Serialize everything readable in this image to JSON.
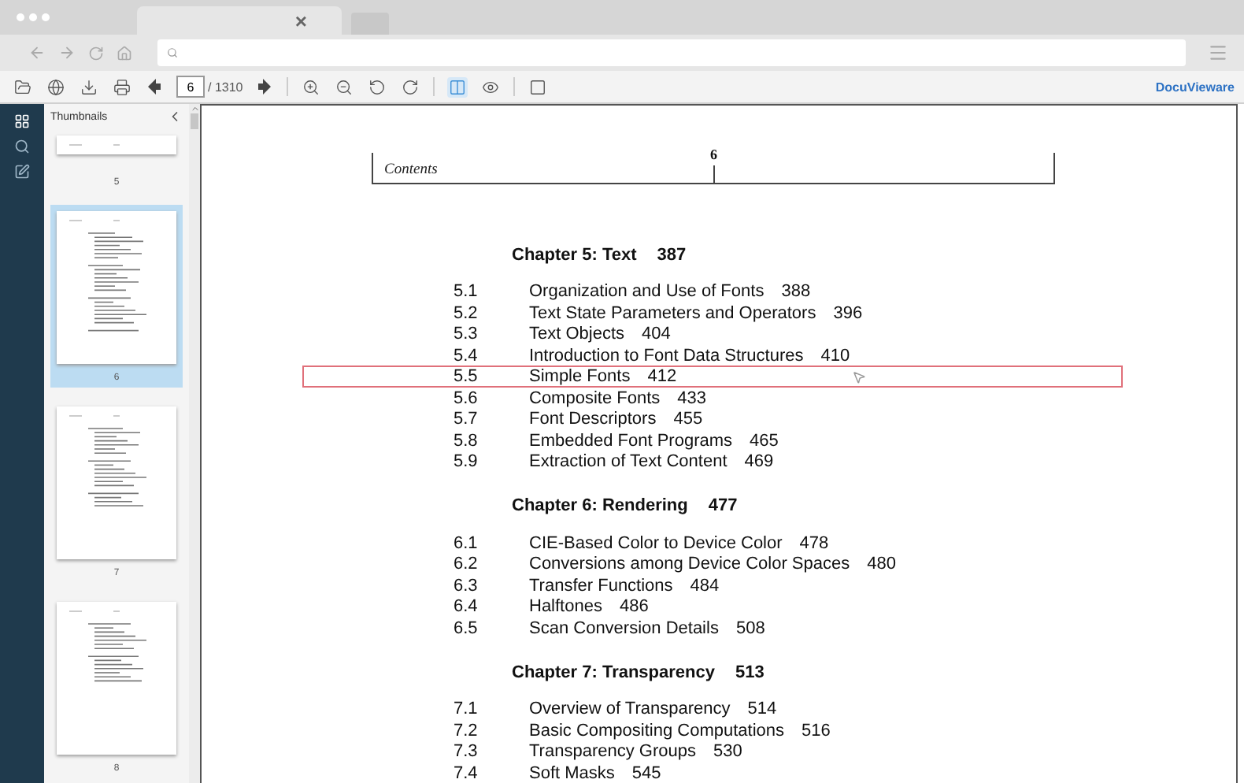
{
  "browser": {
    "tab_close": "×"
  },
  "toolbar": {
    "tools": [
      {
        "kind": "open",
        "selected": false
      },
      {
        "kind": "web",
        "selected": false
      },
      {
        "kind": "download",
        "selected": false
      },
      {
        "kind": "print",
        "selected": false
      },
      {
        "kind": "prev",
        "selected": false
      },
      {
        "kind": "page",
        "selected": false
      },
      {
        "kind": "next",
        "selected": false
      },
      {
        "kind": "zoom-in",
        "selected": false
      },
      {
        "kind": "zoom-out",
        "selected": false
      },
      {
        "kind": "rotate-left",
        "selected": false
      },
      {
        "kind": "rotate-right",
        "selected": false
      },
      {
        "kind": "fit",
        "selected": true
      },
      {
        "kind": "view",
        "selected": false
      },
      {
        "kind": "frame",
        "selected": false
      }
    ],
    "page_input": "6",
    "page_count": "/ 1310",
    "brand": "DocuVieware"
  },
  "sidebar": {
    "title": "Thumbnails",
    "tabs": [
      {
        "kind": "thumbnails",
        "selected": true
      },
      {
        "kind": "search",
        "selected": false
      },
      {
        "kind": "annotate",
        "selected": false
      }
    ],
    "thumbnails": [
      {
        "label": "5",
        "selected": false
      },
      {
        "label": "6",
        "selected": true
      },
      {
        "label": "7",
        "selected": false
      },
      {
        "label": "8",
        "selected": false
      }
    ]
  },
  "document": {
    "running_head": "Contents",
    "page_number": "6",
    "chapters": [
      {
        "title": "Chapter 5: Text",
        "page": "387",
        "entries": [
          {
            "number": "5.1",
            "title": "Organization and Use of Fonts",
            "page": "388",
            "highlighted": false
          },
          {
            "number": "5.2",
            "title": "Text State Parameters and Operators",
            "page": "396",
            "highlighted": false
          },
          {
            "number": "5.3",
            "title": "Text Objects",
            "page": "404",
            "highlighted": false
          },
          {
            "number": "5.4",
            "title": "Introduction to Font Data Structures",
            "page": "410",
            "highlighted": false
          },
          {
            "number": "5.5",
            "title": "Simple Fonts",
            "page": "412",
            "highlighted": true
          },
          {
            "number": "5.6",
            "title": "Composite Fonts",
            "page": "433",
            "highlighted": false
          },
          {
            "number": "5.7",
            "title": "Font Descriptors",
            "page": "455",
            "highlighted": false
          },
          {
            "number": "5.8",
            "title": "Embedded Font Programs",
            "page": "465",
            "highlighted": false
          },
          {
            "number": "5.9",
            "title": "Extraction of Text Content",
            "page": "469",
            "highlighted": false
          }
        ]
      },
      {
        "title": "Chapter 6: Rendering",
        "page": "477",
        "entries": [
          {
            "number": "6.1",
            "title": "CIE-Based Color to Device Color",
            "page": "478",
            "highlighted": false
          },
          {
            "number": "6.2",
            "title": "Conversions among Device Color Spaces",
            "page": "480",
            "highlighted": false
          },
          {
            "number": "6.3",
            "title": "Transfer Functions",
            "page": "484",
            "highlighted": false
          },
          {
            "number": "6.4",
            "title": "Halftones",
            "page": "486",
            "highlighted": false
          },
          {
            "number": "6.5",
            "title": "Scan Conversion Details",
            "page": "508",
            "highlighted": false
          }
        ]
      },
      {
        "title": "Chapter 7: Transparency",
        "page": "513",
        "entries": [
          {
            "number": "7.1",
            "title": "Overview of Transparency",
            "page": "514",
            "highlighted": false
          },
          {
            "number": "7.2",
            "title": "Basic Compositing Computations",
            "page": "516",
            "highlighted": false
          },
          {
            "number": "7.3",
            "title": "Transparency Groups",
            "page": "530",
            "highlighted": false
          },
          {
            "number": "7.4",
            "title": "Soft Masks",
            "page": "545",
            "highlighted": false
          }
        ]
      }
    ]
  }
}
